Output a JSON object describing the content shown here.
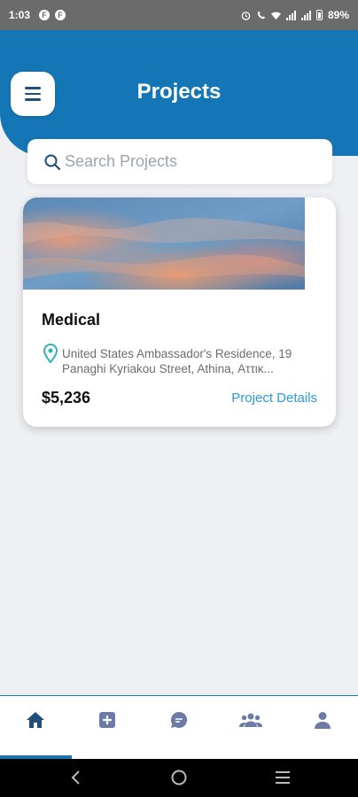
{
  "status_bar": {
    "time": "1:03",
    "notif_1": "F",
    "notif_2": "F",
    "battery": "89%"
  },
  "header": {
    "title": "Projects"
  },
  "search": {
    "placeholder": "Search Projects",
    "value": ""
  },
  "projects": [
    {
      "title": "Medical",
      "address": "United States Ambassador's Residence, 19 Panaghi Kyriakou Street, Athina, Αττικ...",
      "price": "$5,236",
      "details_label": "Project Details"
    }
  ],
  "bottom_nav": {
    "items": [
      "home-icon",
      "add-icon",
      "chat-icon",
      "team-icon",
      "profile-icon"
    ],
    "active": "home-icon"
  },
  "colors": {
    "primary": "#1576b5",
    "link": "#2a9bd4",
    "background": "#eef0f4"
  }
}
